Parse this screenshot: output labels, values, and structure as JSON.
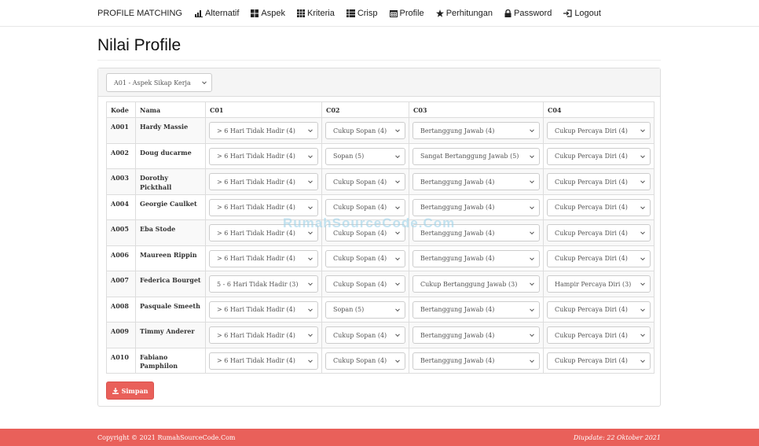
{
  "navbar": {
    "brand": "PROFILE MATCHING",
    "items": [
      {
        "label": "Alternatif",
        "icon": "bar-chart-icon"
      },
      {
        "label": "Aspek",
        "icon": "th-large-icon"
      },
      {
        "label": "Kriteria",
        "icon": "th-icon"
      },
      {
        "label": "Crisp",
        "icon": "th-list-icon"
      },
      {
        "label": "Profile",
        "icon": "calendar-icon"
      },
      {
        "label": "Perhitungan",
        "icon": "star-icon"
      },
      {
        "label": "Password",
        "icon": "lock-icon"
      },
      {
        "label": "Logout",
        "icon": "logout-icon"
      }
    ]
  },
  "page": {
    "title": "Nilai Profile"
  },
  "aspek_filter": {
    "value": "A01 - Aspek Sikap Kerja"
  },
  "table": {
    "headers": [
      "Kode",
      "Nama",
      "C01",
      "C02",
      "C03",
      "C04"
    ],
    "rows": [
      {
        "kode": "A001",
        "nama": "Hardy Massie",
        "c01": "> 6 Hari Tidak Hadir (4)",
        "c02": "Cukup Sopan (4)",
        "c03": "Bertanggung Jawab (4)",
        "c04": "Cukup Percaya Diri (4)"
      },
      {
        "kode": "A002",
        "nama": "Doug ducarme",
        "c01": "> 6 Hari Tidak Hadir (4)",
        "c02": "Sopan (5)",
        "c03": "Sangat Bertanggung Jawab (5)",
        "c04": "Cukup Percaya Diri (4)"
      },
      {
        "kode": "A003",
        "nama": "Dorothy Pickthall",
        "c01": "> 6 Hari Tidak Hadir (4)",
        "c02": "Cukup Sopan (4)",
        "c03": "Bertanggung Jawab (4)",
        "c04": "Cukup Percaya Diri (4)"
      },
      {
        "kode": "A004",
        "nama": "Georgie Caulket",
        "c01": "> 6 Hari Tidak Hadir (4)",
        "c02": "Cukup Sopan (4)",
        "c03": "Bertanggung Jawab (4)",
        "c04": "Cukup Percaya Diri (4)"
      },
      {
        "kode": "A005",
        "nama": "Eba Stode",
        "c01": "> 6 Hari Tidak Hadir (4)",
        "c02": "Cukup Sopan (4)",
        "c03": "Bertanggung Jawab (4)",
        "c04": "Cukup Percaya Diri (4)"
      },
      {
        "kode": "A006",
        "nama": "Maureen Rippin",
        "c01": "> 6 Hari Tidak Hadir (4)",
        "c02": "Cukup Sopan (4)",
        "c03": "Bertanggung Jawab (4)",
        "c04": "Cukup Percaya Diri (4)"
      },
      {
        "kode": "A007",
        "nama": "Federica Bourget",
        "c01": "5 - 6 Hari Tidak Hadir (3)",
        "c02": "Cukup Sopan (4)",
        "c03": "Cukup Bertanggung Jawab (3)",
        "c04": "Hampir Percaya Diri (3)"
      },
      {
        "kode": "A008",
        "nama": "Pasquale Smeeth",
        "c01": "> 6 Hari Tidak Hadir (4)",
        "c02": "Sopan (5)",
        "c03": "Bertanggung Jawab (4)",
        "c04": "Cukup Percaya Diri (4)"
      },
      {
        "kode": "A009",
        "nama": "Timmy Anderer",
        "c01": "> 6 Hari Tidak Hadir (4)",
        "c02": "Cukup Sopan (4)",
        "c03": "Bertanggung Jawab (4)",
        "c04": "Cukup Percaya Diri (4)"
      },
      {
        "kode": "A010",
        "nama": "Fabiano Pamphilon",
        "c01": "> 6 Hari Tidak Hadir (4)",
        "c02": "Cukup Sopan (4)",
        "c03": "Bertanggung Jawab (4)",
        "c04": "Cukup Percaya Diri (4)"
      }
    ]
  },
  "actions": {
    "save_label": "Simpan",
    "save_icon": "download-icon"
  },
  "watermark": "RumahSourceCode.Com",
  "footer": {
    "copyright": "Copyright © 2021 RumahSourceCode.Com",
    "updated": "Diupdate: 22 Oktober 2021"
  },
  "colors": {
    "accent": "#e9605a",
    "border": "#dddddd",
    "panel_head": "#f5f5f5"
  }
}
